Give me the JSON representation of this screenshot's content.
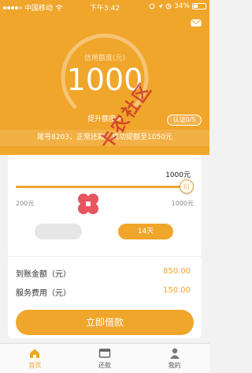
{
  "status_bar": {
    "carrier": "中国移动",
    "time": "下午3:42",
    "battery": "34%"
  },
  "header": {
    "credit_label": "信用额度(元)",
    "credit_value": "1000",
    "raise_limit_link": "提升额度>",
    "auth_badge": "认证0/5",
    "marquee": "尾号8203，正常还款，成功提额至1050元"
  },
  "loan_form": {
    "slider": {
      "current_label": "1000元",
      "min_label": "200元",
      "max_label": "1000元",
      "fill_fraction": 1.0
    },
    "term_selected": "14天",
    "rows": [
      {
        "label": "到账金额（元）",
        "value": "850.00"
      },
      {
        "label": "服务费用（元）",
        "value": "150.00"
      }
    ],
    "submit_label": "立即借款"
  },
  "watermark_text": "卡农社区",
  "tabbar": {
    "items": [
      {
        "label": "首页",
        "icon": "home-icon",
        "active": true
      },
      {
        "label": "还款",
        "icon": "wallet-icon",
        "active": false
      },
      {
        "label": "我的",
        "icon": "user-icon",
        "active": false
      }
    ]
  },
  "colors": {
    "accent": "#f0a52b",
    "marquee_bg": "#f2b045",
    "background": "#f2f2f2"
  }
}
